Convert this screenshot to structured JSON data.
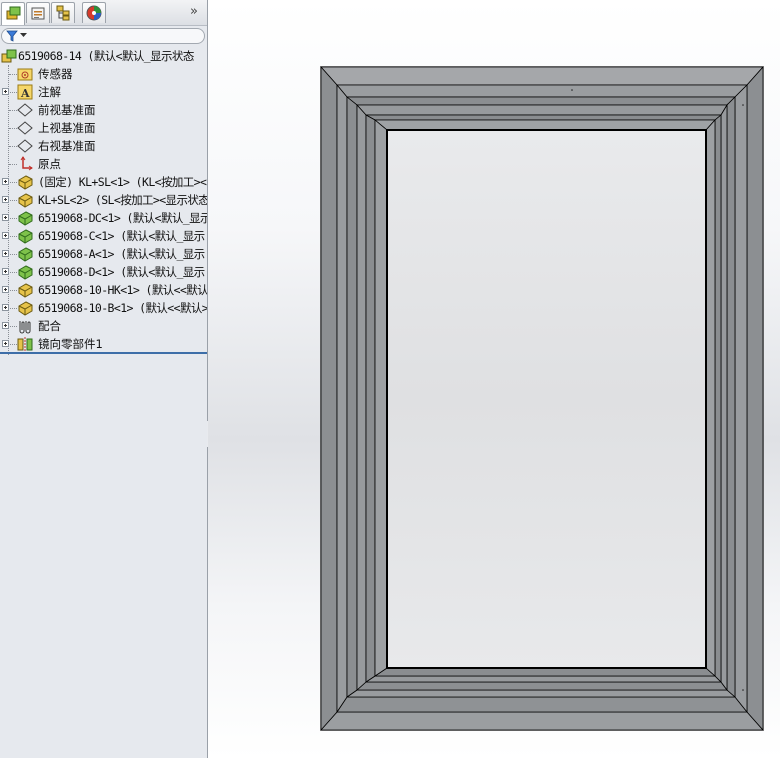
{
  "panel": {
    "tabs": [
      {
        "name": "featuremanager-tab",
        "icon": "feature-tree-icon"
      },
      {
        "name": "propertymanager-tab",
        "icon": "property-manager-icon"
      },
      {
        "name": "configurationmanager-tab",
        "icon": "configuration-manager-icon"
      },
      {
        "name": "displaymanager-tab",
        "icon": "display-manager-icon"
      }
    ],
    "more_label": "»"
  },
  "tree": {
    "root": "6519068-14  (默认<默认_显示状态",
    "items": [
      {
        "label": "传感器",
        "icon": "sensor-folder-icon",
        "expandable": false
      },
      {
        "label": "注解",
        "icon": "annotation-icon",
        "expandable": true
      },
      {
        "label": "前视基准面",
        "icon": "plane-icon",
        "expandable": false
      },
      {
        "label": "上视基准面",
        "icon": "plane-icon",
        "expandable": false
      },
      {
        "label": "右视基准面",
        "icon": "plane-icon",
        "expandable": false
      },
      {
        "label": "原点",
        "icon": "origin-icon",
        "expandable": false
      },
      {
        "label": "(固定) KL+SL<1> (KL<按加工><",
        "icon": "part-yellow-icon",
        "expandable": true
      },
      {
        "label": "KL+SL<2> (SL<按加工><显示状态",
        "icon": "part-yellow-icon",
        "expandable": true
      },
      {
        "label": "6519068-DC<1> (默认<默认_显示",
        "icon": "part-green-icon",
        "expandable": true
      },
      {
        "label": "6519068-C<1> (默认<默认_显示",
        "icon": "part-green-icon",
        "expandable": true
      },
      {
        "label": "6519068-A<1> (默认<默认_显示",
        "icon": "part-green-icon",
        "expandable": true
      },
      {
        "label": "6519068-D<1> (默认<默认_显示",
        "icon": "part-green-icon",
        "expandable": true
      },
      {
        "label": "6519068-10-HK<1> (默认<<默认",
        "icon": "part-yellow-icon",
        "expandable": true
      },
      {
        "label": "6519068-10-B<1> (默认<<默认>",
        "icon": "part-yellow-icon",
        "expandable": true
      },
      {
        "label": "配合",
        "icon": "mates-icon",
        "expandable": true
      },
      {
        "label": "镜向零部件1",
        "icon": "mirror-component-icon",
        "expandable": true
      }
    ]
  },
  "colors": {
    "panel_bg": "#e6e9ee",
    "frame_face": "#8e9194",
    "frame_edge": "#000000",
    "glass": "#e2e3e5",
    "accent_divider": "#3d6ea8"
  }
}
